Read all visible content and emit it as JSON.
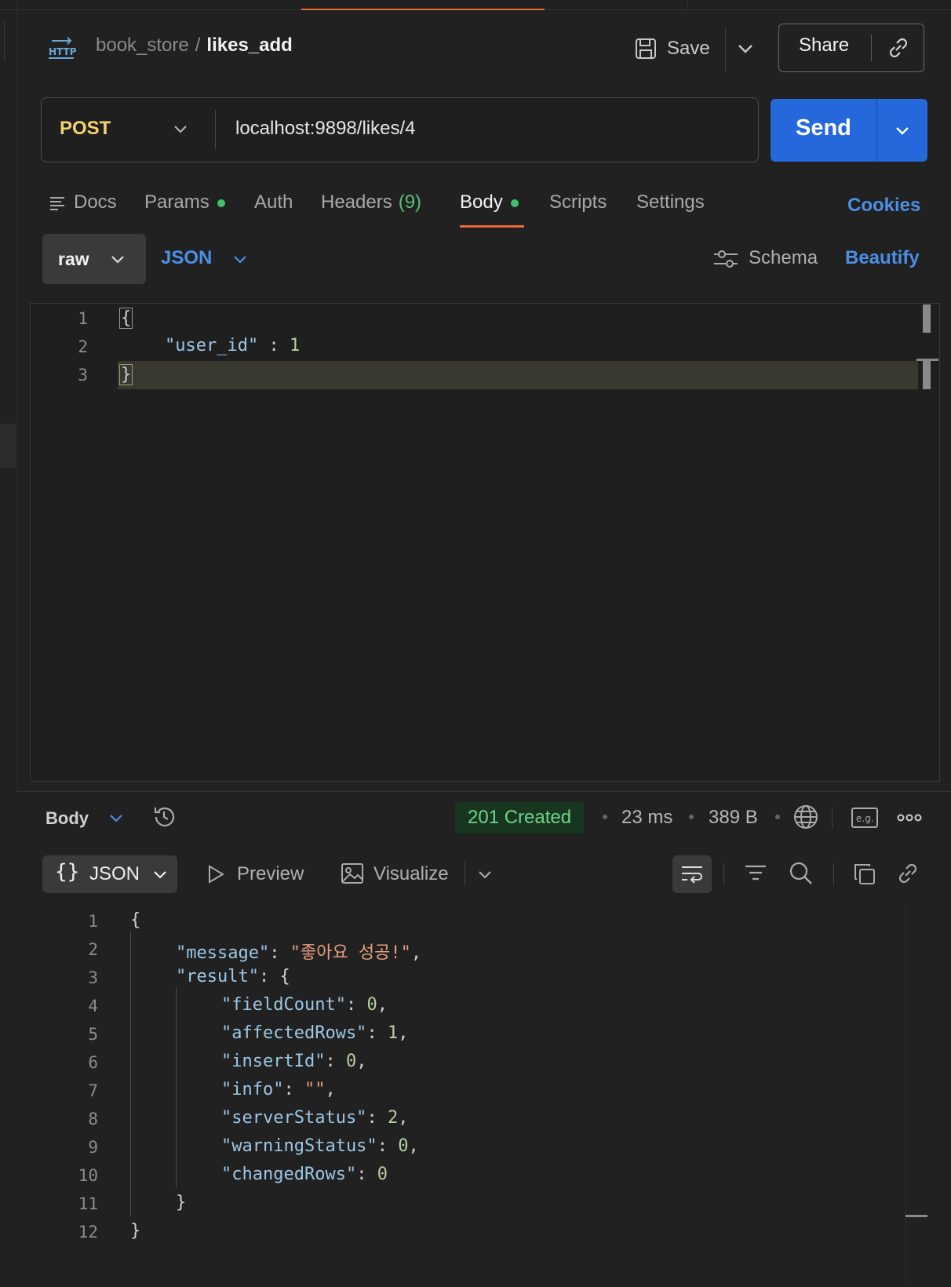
{
  "header": {
    "collection": "book_store",
    "separator": "/",
    "request_name": "likes_add",
    "save_label": "Save",
    "share_label": "Share"
  },
  "request": {
    "method": "POST",
    "url": "localhost:9898/likes/4",
    "send_label": "Send"
  },
  "tabs": [
    {
      "label": "Docs"
    },
    {
      "label": "Params",
      "dot": true
    },
    {
      "label": "Auth"
    },
    {
      "label": "Headers",
      "count": "(9)"
    },
    {
      "label": "Body",
      "dot": true,
      "active": true
    },
    {
      "label": "Scripts"
    },
    {
      "label": "Settings"
    }
  ],
  "cookies_label": "Cookies",
  "body_options": {
    "mode": "raw",
    "format": "JSON",
    "schema_label": "Schema",
    "beautify_label": "Beautify"
  },
  "request_body": {
    "line_numbers": [
      "1",
      "2",
      "3"
    ],
    "line1": "{",
    "key": "\"user_id\"",
    "colon": " : ",
    "value": "1",
    "line3": "}"
  },
  "response": {
    "section_label": "Body",
    "status": "201 Created",
    "time": "23 ms",
    "size": "389 B",
    "format_label": "JSON",
    "format_brace": "{}",
    "preview_label": "Preview",
    "visualize_label": "Visualize",
    "line_numbers": [
      "1",
      "2",
      "3",
      "4",
      "5",
      "6",
      "7",
      "8",
      "9",
      "10",
      "11",
      "12"
    ],
    "l1": "{",
    "message_key": "\"message\"",
    "message_value": "\"좋아요 성공!\"",
    "result_key": "\"result\"",
    "fields": [
      {
        "key": "\"fieldCount\"",
        "value": "0",
        "comma": ","
      },
      {
        "key": "\"affectedRows\"",
        "value": "1",
        "comma": ","
      },
      {
        "key": "\"insertId\"",
        "value": "0",
        "comma": ","
      },
      {
        "key": "\"info\"",
        "value": "\"\"",
        "comma": ","
      },
      {
        "key": "\"serverStatus\"",
        "value": "2",
        "comma": ","
      },
      {
        "key": "\"warningStatus\"",
        "value": "0",
        "comma": ","
      },
      {
        "key": "\"changedRows\"",
        "value": "0",
        "comma": ""
      }
    ],
    "l11": "}",
    "l12": "}"
  },
  "colors": {
    "accent_orange": "#e86a3b",
    "send_blue": "#2468db",
    "link_blue": "#4c8fe6",
    "method_yellow": "#f3d36c",
    "status_green": "#6fd48a"
  }
}
